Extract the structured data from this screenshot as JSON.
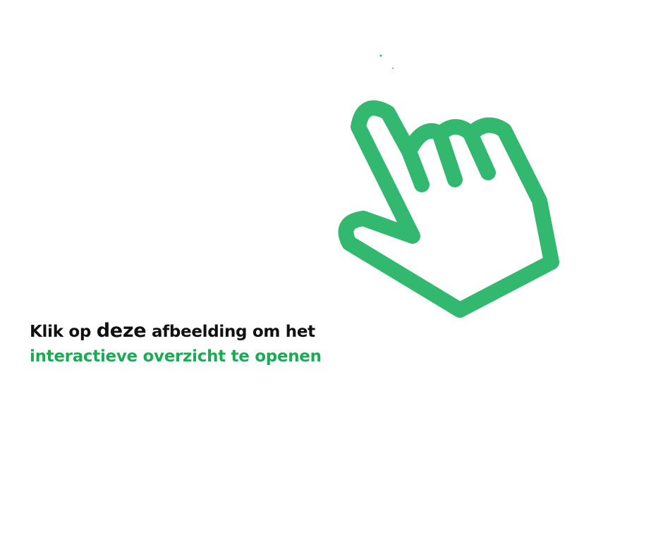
{
  "caption": {
    "line1_start": "Klik op ",
    "line1_emphasis": "deze",
    "line1_end": " afbeelding om het",
    "line2": "interactieve overzicht te openen"
  },
  "icon": "pointing-hand-icon",
  "colors": {
    "hand": "#33b96f",
    "accent_text": "#1aac55",
    "text": "#111111"
  }
}
